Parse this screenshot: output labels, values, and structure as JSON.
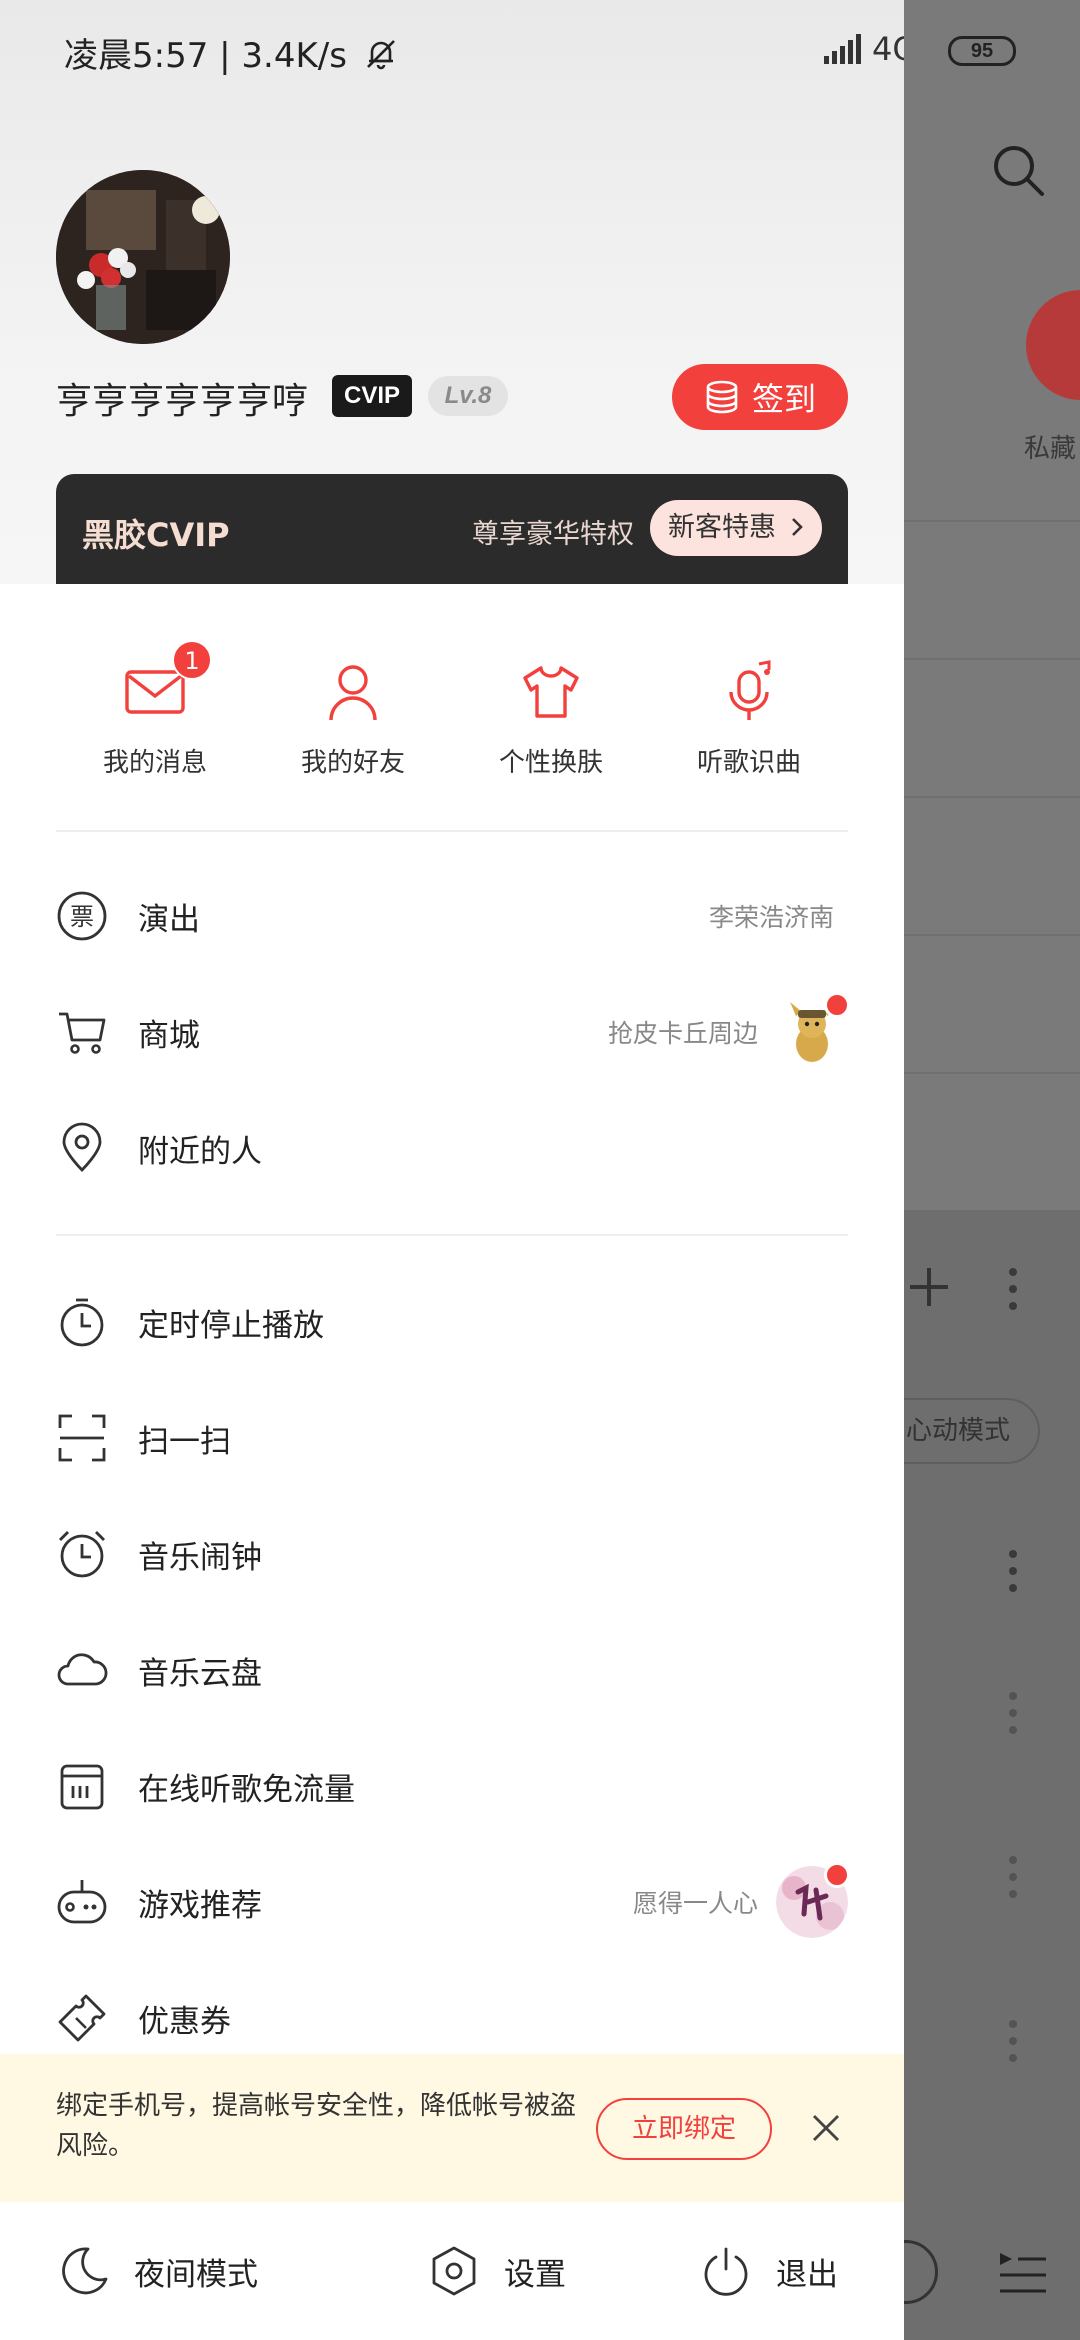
{
  "status_bar": {
    "time_speed": "凌晨5:57 | 3.4K/s",
    "network": "4G",
    "battery": "95"
  },
  "profile": {
    "username": "亨亨亨亨亨亨哼",
    "vip_badge": "CVIP",
    "level": "Lv.8",
    "signin_label": "签到"
  },
  "vip_card": {
    "logo": "黑胶CVIP",
    "text": "尊享豪华特权",
    "pill": "新客特惠"
  },
  "quick_actions": [
    {
      "label": "我的消息",
      "icon": "mail-icon",
      "badge": "1"
    },
    {
      "label": "我的好友",
      "icon": "friend-icon"
    },
    {
      "label": "个性换肤",
      "icon": "shirt-icon"
    },
    {
      "label": "听歌识曲",
      "icon": "mic-music-icon"
    }
  ],
  "menu": [
    {
      "label": "演出",
      "icon": "ticket-icon",
      "hint": "李荣浩济南"
    },
    {
      "label": "商城",
      "icon": "cart-icon",
      "hint": "抢皮卡丘周边"
    },
    {
      "label": "附近的人",
      "icon": "location-icon"
    },
    {
      "label": "定时停止播放",
      "icon": "timer-icon"
    },
    {
      "label": "扫一扫",
      "icon": "scan-icon"
    },
    {
      "label": "音乐闹钟",
      "icon": "alarm-icon"
    },
    {
      "label": "音乐云盘",
      "icon": "cloud-icon"
    },
    {
      "label": "在线听歌免流量",
      "icon": "sim-icon"
    },
    {
      "label": "游戏推荐",
      "icon": "game-icon",
      "hint": "愿得一人心"
    },
    {
      "label": "优惠券",
      "icon": "coupon-icon"
    }
  ],
  "bind_banner": {
    "text": "绑定手机号，提高帐号安全性，降低帐号被盗风险。",
    "button": "立即绑定"
  },
  "bottom_bar": {
    "night_mode": "夜间模式",
    "settings": "设置",
    "logout": "退出"
  },
  "background": {
    "label_private": "私藏",
    "heart_mode": "心动模式"
  },
  "colors": {
    "accent": "#f2403c",
    "banner_bg": "#fff8e3",
    "vip_card": "#2b2b2b"
  }
}
